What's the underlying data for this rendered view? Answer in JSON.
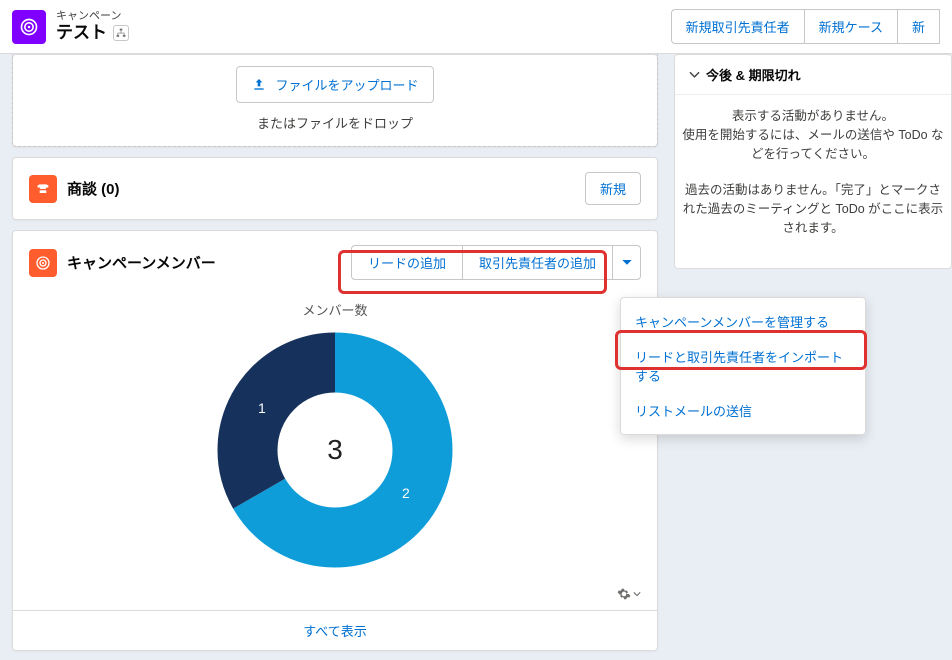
{
  "header": {
    "record_type": "キャンペーン",
    "title": "テスト",
    "actions": {
      "new_contact": "新規取引先責任者",
      "new_case": "新規ケース",
      "new_cut": "新"
    }
  },
  "files": {
    "upload_label": "ファイルをアップロード",
    "drop_label": "またはファイルをドロップ"
  },
  "opportunities": {
    "title": "商談 (0)",
    "new_label": "新規"
  },
  "campaign_members": {
    "title": "キャンペーンメンバー",
    "add_leads": "リードの追加",
    "add_contacts": "取引先責任者の追加",
    "chart_title": "メンバー数",
    "view_all": "すべて表示"
  },
  "dropdown": {
    "manage": "キャンペーンメンバーを管理する",
    "import": "リードと取引先責任者をインポートする",
    "list_email": "リストメールの送信"
  },
  "side": {
    "header": "今後 & 期限切れ",
    "msg1a": "表示する活動がありません。",
    "msg1b": "使用を開始するには、メールの送信や ToDo などを行ってください。",
    "msg2": "過去の活動はありません。「完了」とマークされた過去のミーティングと ToDo がここに表示されます。"
  },
  "chart_data": {
    "type": "pie",
    "title": "メンバー数",
    "categories": [
      "1",
      "2"
    ],
    "values": [
      1,
      2
    ],
    "total": 3,
    "colors": [
      "#16325c",
      "#0e9dd9"
    ]
  }
}
